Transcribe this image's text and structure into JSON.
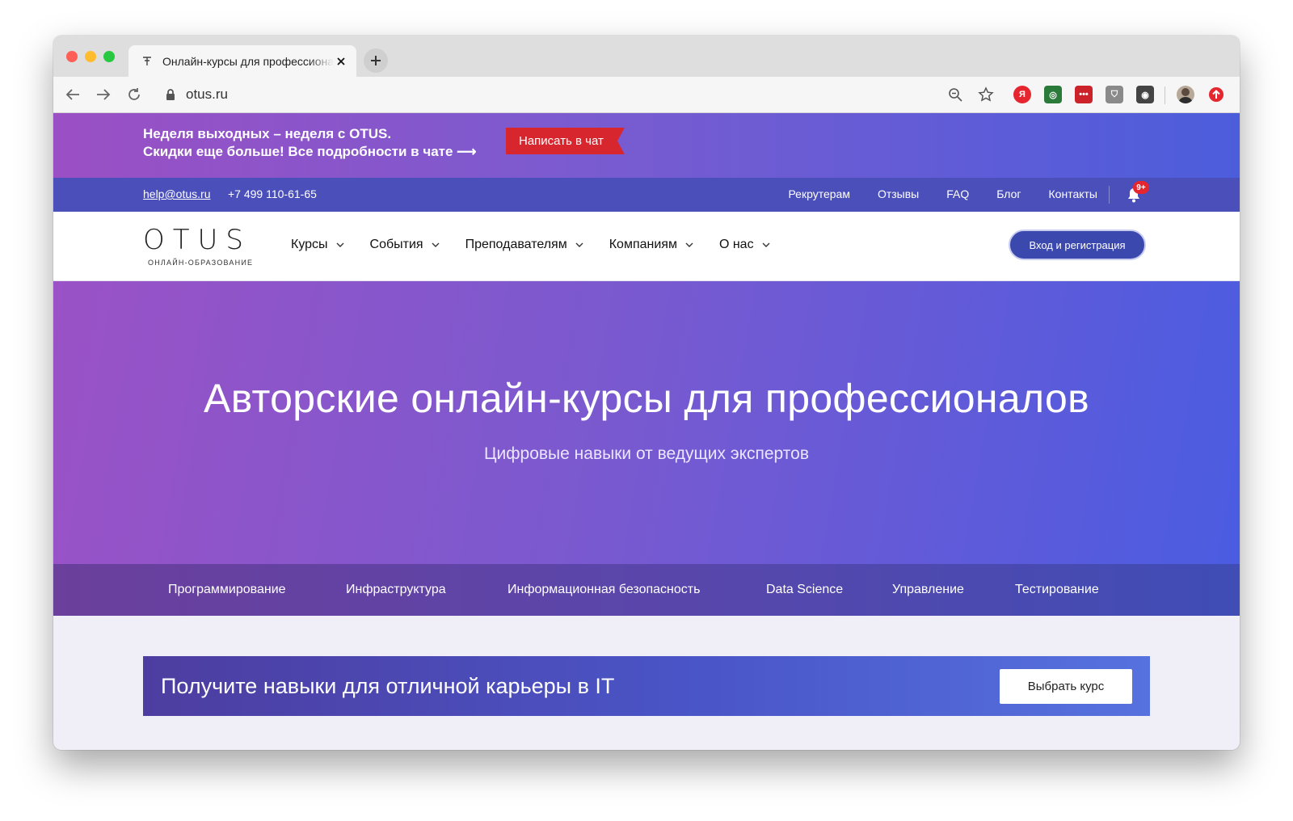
{
  "browser": {
    "tab_title": "Онлайн-курсы для профессионалов",
    "url": "otus.ru",
    "extensions": [
      {
        "name": "yandex-icon",
        "glyph": "Я",
        "color": "#e5262f"
      },
      {
        "name": "grammarly-icon",
        "glyph": "◎",
        "color": "#2a7a3a"
      },
      {
        "name": "lastpass-icon",
        "glyph": "•••",
        "color": "#cc2229"
      },
      {
        "name": "extension-icon",
        "glyph": "⛉",
        "color": "#8a8a8a"
      },
      {
        "name": "lightbulb-icon",
        "glyph": "◉",
        "color": "#444444"
      }
    ],
    "update_color": "#e5262f"
  },
  "promo": {
    "line1": "Неделя выходных – неделя с OTUS.",
    "line2": "Скидки еще больше! Все подробности в чате ⟶",
    "button": "Написать в чат"
  },
  "infobar": {
    "email": "help@otus.ru",
    "phone": "+7 499 110-61-65",
    "links": [
      "Рекрутерам",
      "Отзывы",
      "FAQ",
      "Блог",
      "Контакты"
    ],
    "notifications_badge": "9+"
  },
  "header": {
    "logo_text": "OTUS",
    "logo_subtitle": "ОНЛАЙН-ОБРАЗОВАНИЕ",
    "nav": [
      "Курсы",
      "События",
      "Преподавателям",
      "Компаниям",
      "О нас"
    ],
    "login_button": "Вход и регистрация"
  },
  "hero": {
    "title": "Авторские онлайн-курсы для профессионалов",
    "subtitle": "Цифровые навыки от ведущих экспертов"
  },
  "categories": [
    "Программирование",
    "Инфраструктура",
    "Информационная безопасность",
    "Data Science",
    "Управление",
    "Тестирование"
  ],
  "cta": {
    "text": "Получите навыки для отличной карьеры в IT",
    "button": "Выбрать курс"
  },
  "colors": {
    "accent": "#4a4fba",
    "promo_button": "#d7262e",
    "login_button": "#3b48ad"
  }
}
